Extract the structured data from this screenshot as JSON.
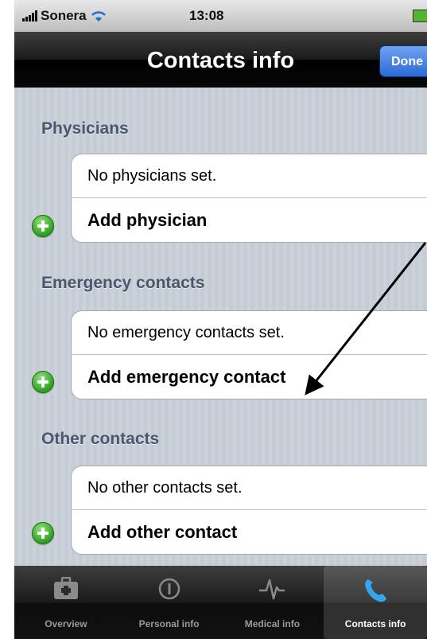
{
  "status_bar": {
    "carrier": "Sonera",
    "time": "13:08"
  },
  "nav": {
    "title": "Contacts info",
    "done_label": "Done"
  },
  "sections": [
    {
      "header": "Physicians",
      "info": "No physicians set.",
      "add": "Add physician"
    },
    {
      "header": "Emergency contacts",
      "info": "No emergency contacts set.",
      "add": "Add emergency contact"
    },
    {
      "header": "Other contacts",
      "info": "No other contacts set.",
      "add": "Add other contact"
    }
  ],
  "tabs": [
    {
      "label": "Overview",
      "icon": "first-aid-kit-icon"
    },
    {
      "label": "Personal info",
      "icon": "info-icon"
    },
    {
      "label": "Medical info",
      "icon": "heartbeat-icon"
    },
    {
      "label": "Contacts info",
      "icon": "phone-icon",
      "selected": true
    }
  ],
  "colors": {
    "accent": "#2a6ad8",
    "add_icon": "#2f9f1f",
    "section_header": "#4c566c"
  }
}
